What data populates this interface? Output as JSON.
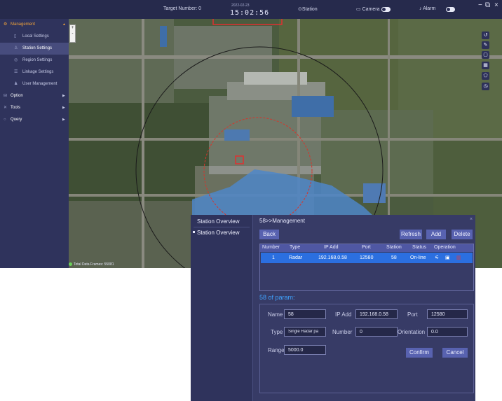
{
  "header": {
    "target_number": "Target Number: 0",
    "date": "2022-02-23",
    "time": "15:02:56",
    "station": "Station",
    "camera": "Camera",
    "alarm": "Alarm",
    "window_minimize": "−",
    "window_restore": "⧉",
    "window_close": "×"
  },
  "sidebar": {
    "management": "Management",
    "items": [
      {
        "label": "Local Settings"
      },
      {
        "label": "Station Settings"
      },
      {
        "label": "Region Settings"
      },
      {
        "label": "Linkage Settings"
      },
      {
        "label": "User Management"
      }
    ],
    "option": "Option",
    "tools": "Tools",
    "query": "Query"
  },
  "map": {
    "zoom_in": "+",
    "zoom_out": "-",
    "status_text": "Total Data Frames: 55081"
  },
  "dialog": {
    "left_title": "Station Overview",
    "left_item": "Station Overview",
    "breadcrumb": "58>>Management",
    "close": "×",
    "buttons": {
      "back": "Back",
      "refresh": "Refresh",
      "add": "Add",
      "delete": "Delete",
      "confirm": "Confirm",
      "cancel": "Cancel"
    },
    "table": {
      "headers": [
        "Number",
        "Type",
        "IP Add",
        "Port",
        "Station",
        "Status",
        "Operation"
      ],
      "rows": [
        {
          "number": "1",
          "type": "Radar",
          "ip": "192.168.0.58",
          "port": "12580",
          "station": "58",
          "status": "On-line"
        }
      ]
    },
    "param_title": "58 of param:",
    "params": {
      "name_label": "Name",
      "name_value": "58",
      "ip_label": "IP Add",
      "ip_value": "192.168.0.58",
      "port_label": "Port",
      "port_value": "12580",
      "type_label": "Type",
      "type_value": "Single Radar pa",
      "number_label": "Number",
      "number_value": "0",
      "orientation_label": "Orientation",
      "orientation_value": "0.0",
      "range_label": "Range",
      "range_value": "5000.0"
    }
  },
  "colors": {
    "accent": "#f0a23a",
    "selected_row": "#2b6fe0",
    "button": "#5862b0",
    "param_title": "#3fa3ff"
  }
}
